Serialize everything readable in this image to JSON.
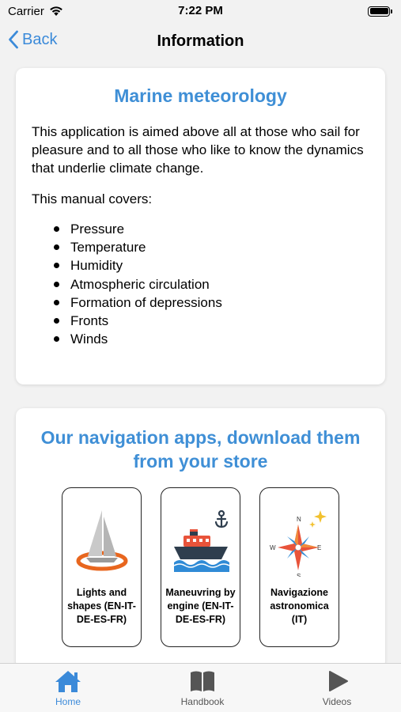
{
  "status": {
    "carrier": "Carrier",
    "time": "7:22 PM"
  },
  "nav": {
    "back_label": "Back",
    "title": "Information"
  },
  "intro_card": {
    "title": "Marine meteorology",
    "text": "This application is aimed above all at those who sail for pleasure and to all those who like to know the dynamics that underlie climate change.",
    "covers_label": "This manual covers:",
    "topics": [
      "Pressure",
      "Temperature",
      "Humidity",
      "Atmospheric circulation",
      "Formation of depressions",
      "Fronts",
      "Winds"
    ]
  },
  "apps_card": {
    "title": "Our navigation apps, download them from your store",
    "apps": [
      {
        "name": "Lights and shapes (EN-IT-DE-ES-FR)",
        "icon": "sailboat-icon"
      },
      {
        "name": "Maneuvring by engine (EN-IT-DE-ES-FR)",
        "icon": "ship-anchor-icon"
      },
      {
        "name": "Navigazione astronomica (IT)",
        "icon": "compass-star-icon"
      }
    ]
  },
  "tabs": [
    {
      "label": "Home",
      "icon": "home-icon",
      "active": true
    },
    {
      "label": "Handbook",
      "icon": "book-icon",
      "active": false
    },
    {
      "label": "Videos",
      "icon": "play-icon",
      "active": false
    }
  ],
  "colors": {
    "accent": "#3b8ad9",
    "title_blue": "#3f8fd6",
    "background": "#f2f2f2"
  }
}
